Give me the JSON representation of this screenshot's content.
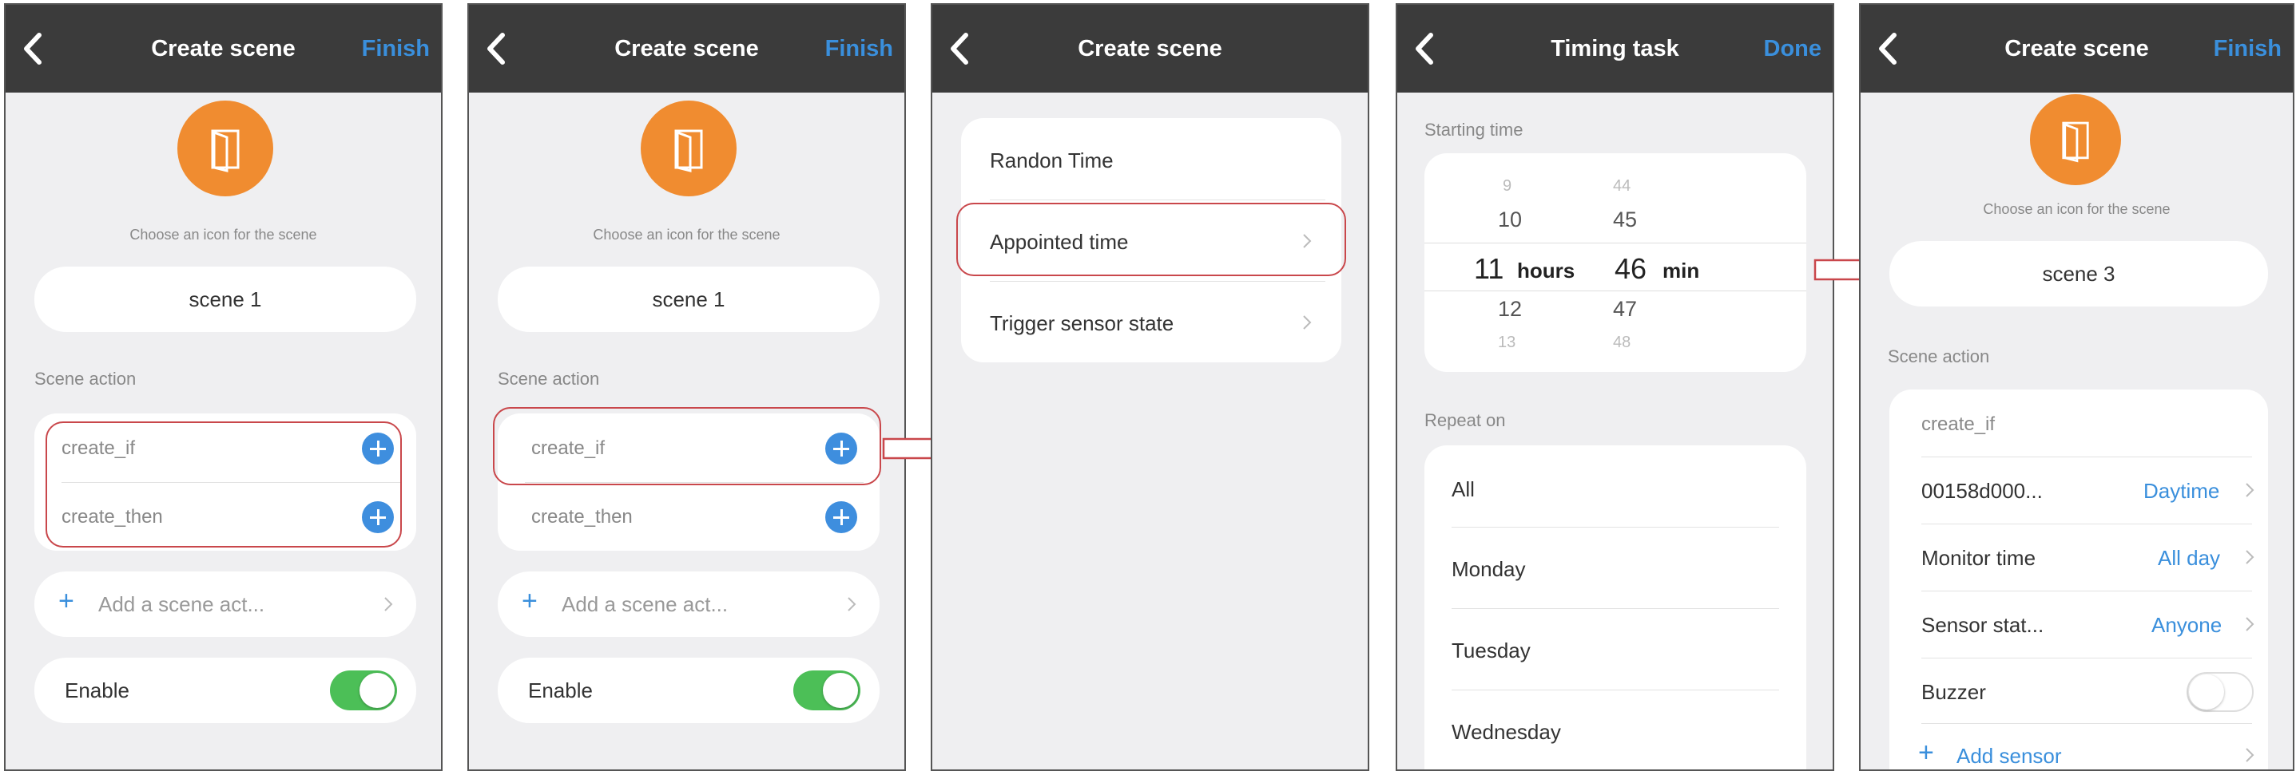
{
  "screens": [
    {
      "nav": {
        "title": "Create scene",
        "action": "Finish"
      },
      "icon_caption": "Choose an icon for the scene",
      "scene_name": "scene 1",
      "section_label": "Scene action",
      "actions": [
        "create_if",
        "create_then"
      ],
      "add_label": "Add a scene act...",
      "enable_label": "Enable"
    },
    {
      "nav": {
        "title": "Create scene",
        "action": "Finish"
      },
      "icon_caption": "Choose an icon for the scene",
      "scene_name": "scene 1",
      "section_label": "Scene action",
      "actions": [
        "create_if",
        "create_then"
      ],
      "add_label": "Add a scene act...",
      "enable_label": "Enable"
    },
    {
      "nav": {
        "title": "Create scene"
      },
      "options": [
        "Randon Time",
        "Appointed time",
        "Trigger sensor state"
      ]
    },
    {
      "nav": {
        "title": "Timing task",
        "action": "Done"
      },
      "starting_label": "Starting time",
      "picker": {
        "hours": [
          "9",
          "10",
          "11",
          "12",
          "13"
        ],
        "minutes": [
          "44",
          "45",
          "46",
          "47",
          "48"
        ],
        "hours_unit": "hours",
        "minutes_unit": "min"
      },
      "repeat_label": "Repeat on",
      "repeat_days": [
        "All",
        "Monday",
        "Tuesday",
        "Wednesday"
      ]
    },
    {
      "nav": {
        "title": "Create scene",
        "action": "Finish"
      },
      "icon_caption": "Choose an icon for the scene",
      "scene_name": "scene 3",
      "section_label": "Scene action",
      "card_header": "create_if",
      "rows": [
        {
          "label": "00158d000...",
          "value": "Daytime"
        },
        {
          "label": "Monitor time",
          "value": "All day"
        },
        {
          "label": "Sensor stat...",
          "value": "Anyone"
        }
      ],
      "buzzer_label": "Buzzer",
      "add_sensor_label": "Add sensor"
    }
  ],
  "colors": {
    "accent": "#3a8fdc",
    "nav_bg": "#3b3b3b",
    "icon_orange": "#f08c30",
    "toggle_on": "#4cbf57",
    "highlight": "#c9474b"
  }
}
